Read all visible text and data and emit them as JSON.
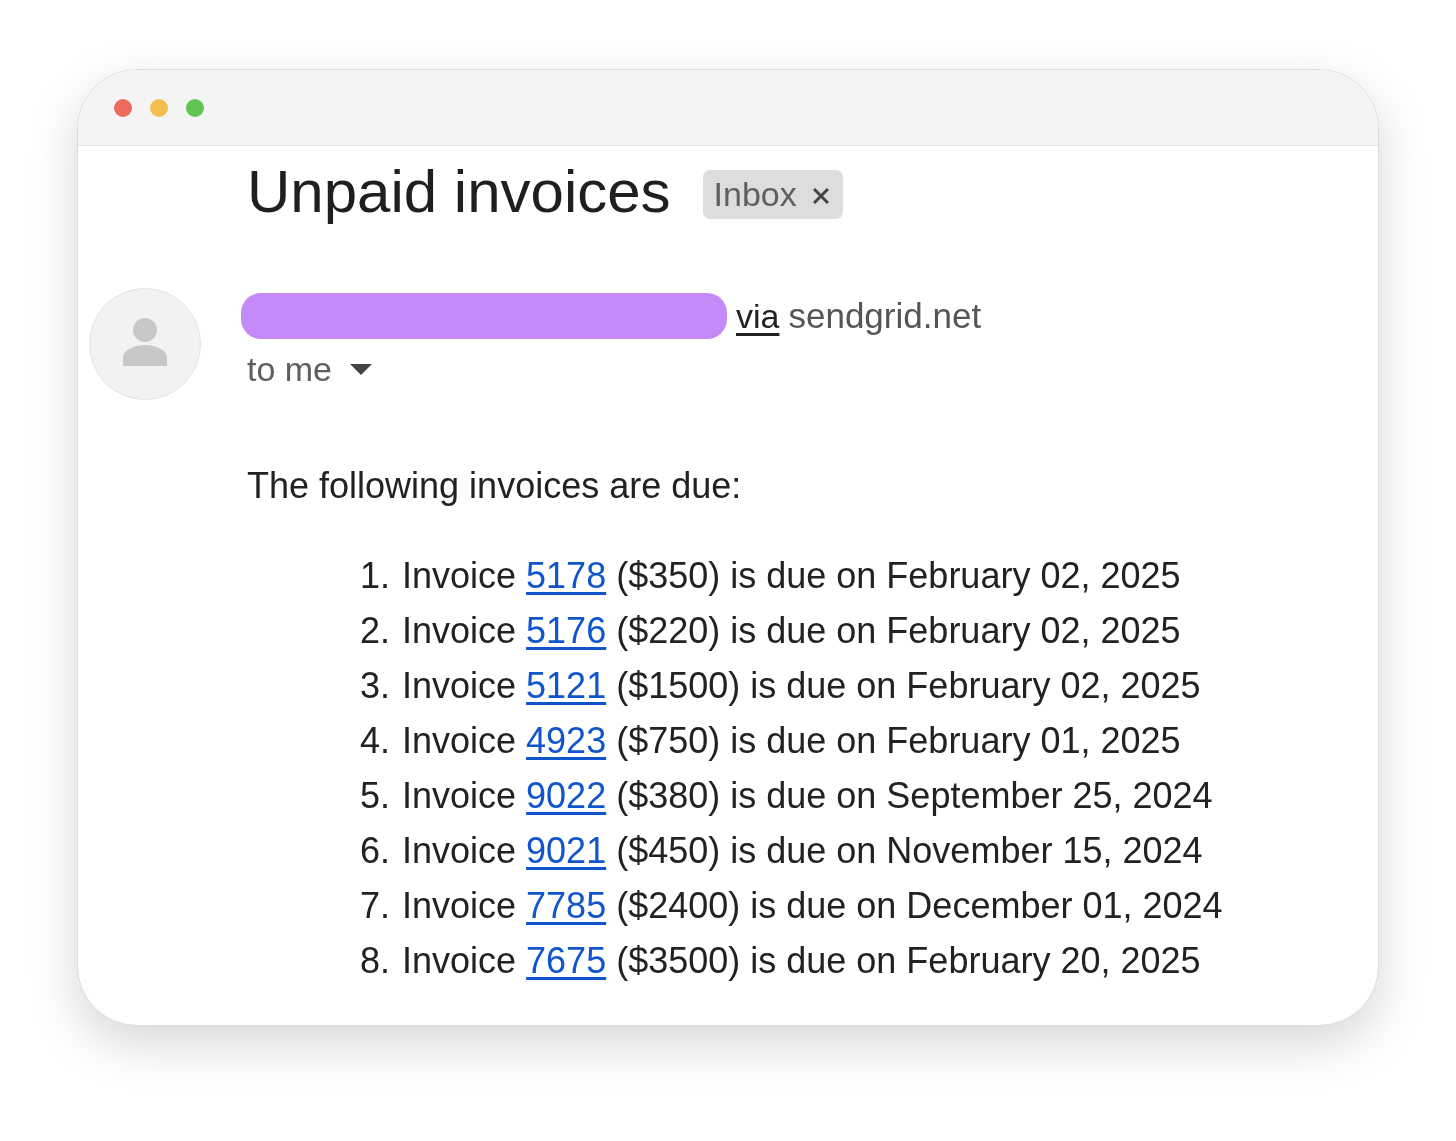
{
  "window": {
    "controls": [
      {
        "color": "#ed6a5e"
      },
      {
        "color": "#f5bf4f"
      },
      {
        "color": "#61c554"
      }
    ]
  },
  "message": {
    "subject": "Unpaid invoices",
    "labels": [
      {
        "text": "Inbox",
        "removable": true
      }
    ]
  },
  "sender": {
    "redacted": true,
    "via": "via",
    "domain": "sendgrid.net"
  },
  "recipient": {
    "text": "to me",
    "expanded": false
  },
  "body": {
    "intro": "The following invoices are due:",
    "invoices": [
      {
        "number": "1.",
        "label": "Invoice",
        "link": "5178",
        "details": "($350) is due on February 02, 2025"
      },
      {
        "number": "2.",
        "label": "Invoice",
        "link": "5176",
        "details": "($220) is due on February 02, 2025"
      },
      {
        "number": "3.",
        "label": "Invoice",
        "link": "5121",
        "details": "($1500) is due on February 02, 2025"
      },
      {
        "number": "4.",
        "label": "Invoice",
        "link": "4923",
        "details": "($750) is due on February 01, 2025"
      },
      {
        "number": "5.",
        "label": "Invoice",
        "link": "9022",
        "details": "($380) is due on September 25, 2024"
      },
      {
        "number": "6.",
        "label": "Invoice",
        "link": "9021",
        "details": "($450) is due on November 15, 2024"
      },
      {
        "number": "7.",
        "label": "Invoice",
        "link": "7785",
        "details": "($2400) is due on December 01, 2024"
      },
      {
        "number": "8.",
        "label": "Invoice",
        "link": "7675",
        "details": "($3500) is due on February 20, 2025"
      }
    ]
  }
}
